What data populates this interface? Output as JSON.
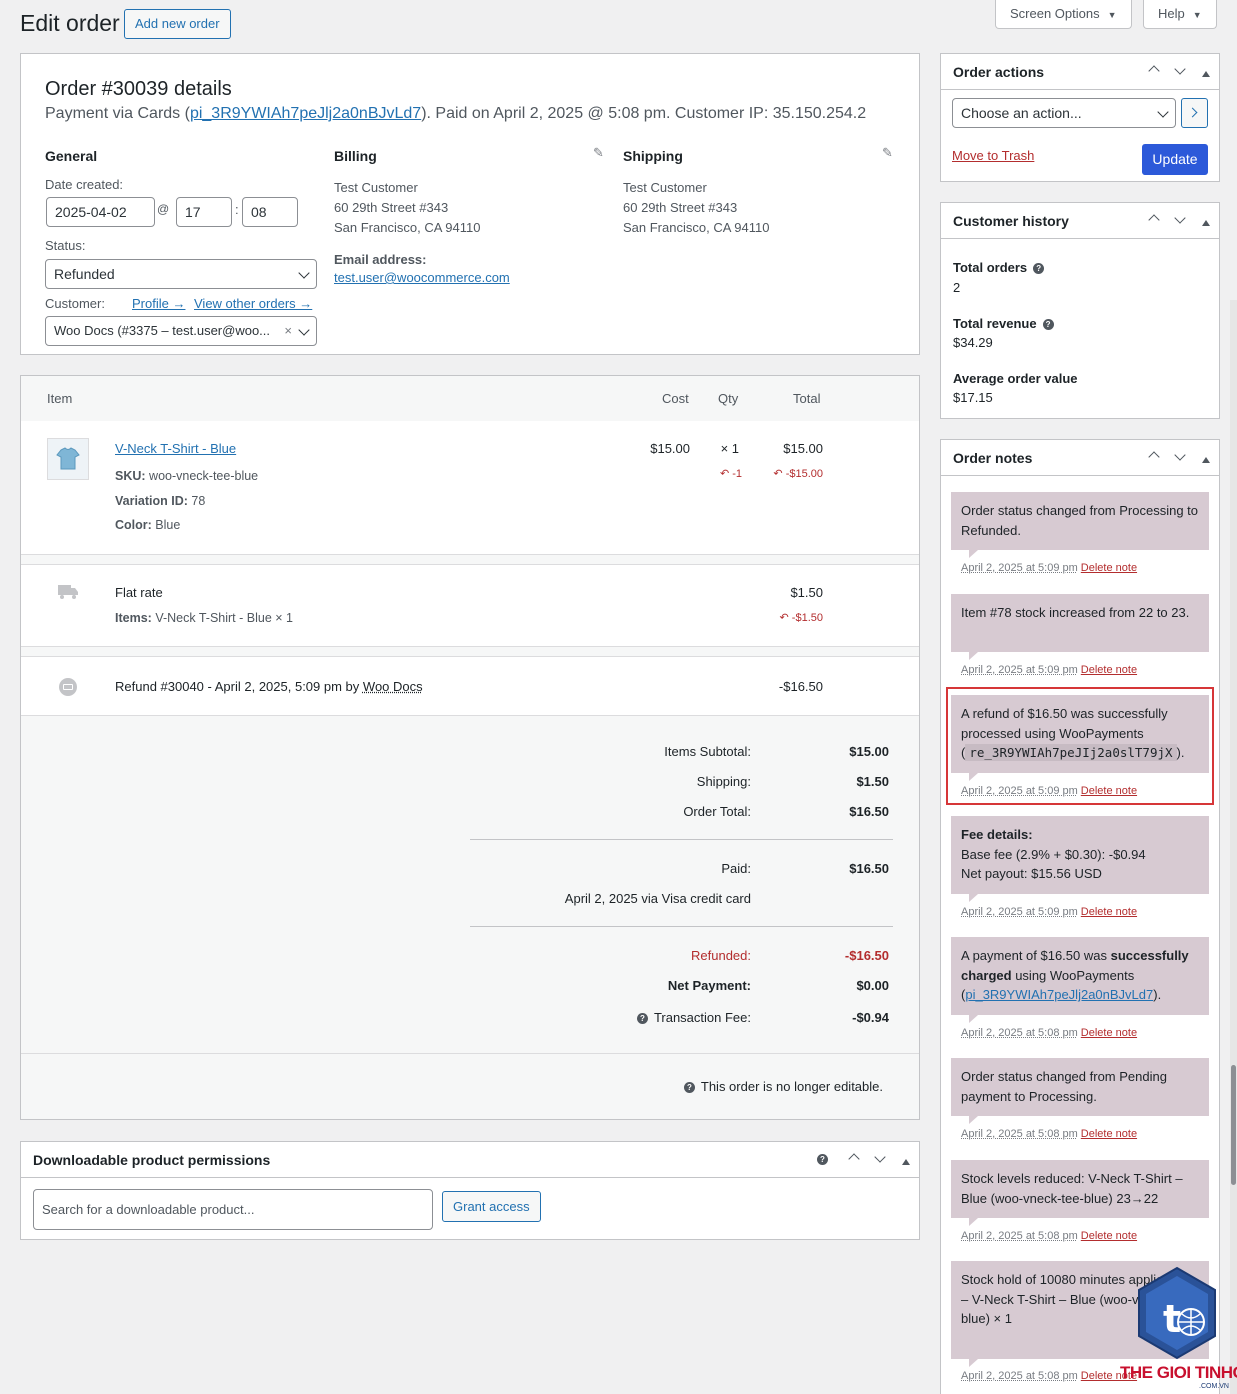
{
  "header": {
    "title": "Edit order",
    "add_new_label": "Add new order",
    "screen_options_label": "Screen Options",
    "help_label": "Help"
  },
  "order": {
    "heading": "Order #30039 details",
    "payment_prefix": "Payment via Cards (",
    "payment_id": "pi_3R9YWIAh7peJlj2a0nBJvLd7",
    "payment_suffix": "). Paid on April 2, 2025 @ 5:08 pm. Customer IP: 35.150.254.2",
    "general": {
      "title": "General",
      "date_label": "Date created:",
      "date": "2025-04-02",
      "hour": "17",
      "minute": "08",
      "at_sign": "@",
      "colon": ":",
      "status_label": "Status:",
      "status": "Refunded",
      "customer_label": "Customer:",
      "profile_link": "Profile →",
      "other_orders_link": "View other orders →",
      "customer": "Woo Docs (#3375 – test.user@woo..."
    },
    "billing": {
      "title": "Billing",
      "name": "Test Customer",
      "street": "60 29th Street #343",
      "city": "San Francisco, CA 94110",
      "email_label": "Email address:",
      "email": "test.user@woocommerce.com"
    },
    "shipping": {
      "title": "Shipping",
      "name": "Test Customer",
      "street": "60 29th Street #343",
      "city": "San Francisco, CA 94110"
    }
  },
  "items": {
    "headers": {
      "item": "Item",
      "cost": "Cost",
      "qty": "Qty",
      "total": "Total"
    },
    "product": {
      "name": "V-Neck T-Shirt - Blue",
      "sku_label": "SKU:",
      "sku": "woo-vneck-tee-blue",
      "variation_label": "Variation ID:",
      "variation": "78",
      "color_label": "Color:",
      "color": "Blue",
      "cost": "$15.00",
      "qty": "× 1",
      "total": "$15.00",
      "refund_qty": "-1",
      "refund_total": "-$15.00"
    },
    "shipping": {
      "name": "Flat rate",
      "items_label": "Items:",
      "items": "V-Neck T-Shirt - Blue × 1",
      "total": "$1.50",
      "refund_total": "-$1.50"
    },
    "refund": {
      "text": "Refund #30040 - April 2, 2025, 5:09 pm by",
      "by": "Woo Docs",
      "total": "-$16.50"
    },
    "totals": {
      "subtotal_label": "Items Subtotal:",
      "subtotal": "$15.00",
      "shipping_label": "Shipping:",
      "shipping": "$1.50",
      "order_total_label": "Order Total:",
      "order_total": "$16.50",
      "paid_label": "Paid:",
      "paid": "$16.50",
      "paid_via": "April 2, 2025 via Visa credit card",
      "refunded_label": "Refunded:",
      "refunded": "-$16.50",
      "net_label": "Net Payment:",
      "net": "$0.00",
      "fee_label": "Transaction Fee:",
      "fee": "-$0.94"
    },
    "not_editable": "This order is no longer editable."
  },
  "downloads": {
    "title": "Downloadable product permissions",
    "search_placeholder": "Search for a downloadable product...",
    "grant_label": "Grant access"
  },
  "order_actions": {
    "title": "Order actions",
    "select": "Choose an action...",
    "trash": "Move to Trash",
    "update": "Update"
  },
  "customer_history": {
    "title": "Customer history",
    "total_orders_label": "Total orders",
    "total_orders": "2",
    "total_revenue_label": "Total revenue",
    "total_revenue": "$34.29",
    "aov_label": "Average order value",
    "aov": "$17.15"
  },
  "order_notes": {
    "title": "Order notes",
    "delete_label": "Delete note",
    "notes": [
      {
        "text": "Order status changed from Processing to Refunded.",
        "date": "April 2, 2025 at 5:09 pm"
      },
      {
        "text": "Item #78 stock increased from 22 to 23.",
        "date": "April 2, 2025 at 5:09 pm"
      },
      {
        "text_a": "A refund of $16.50 was successfully processed using WooPayments",
        "code": "re_3R9YWIAh7peJIj2a0slT79jX",
        "date": "April 2, 2025 at 5:09 pm"
      },
      {
        "title": "Fee details:",
        "line1": "Base fee (2.9% + $0.30): -$0.94",
        "line2": "Net payout: $15.56 USD",
        "date": "April 2, 2025 at 5:09 pm"
      },
      {
        "text_a": "A payment of $16.50 was",
        "bold": "successfully charged",
        "text_b": "using WooPayments",
        "link": "pi_3R9YWIAh7peJlj2a0nBJvLd7",
        "date": "April 2, 2025 at 5:08 pm"
      },
      {
        "text": "Order status changed from Pending payment to Processing.",
        "date": "April 2, 2025 at 5:08 pm"
      },
      {
        "text": "Stock levels reduced: V-Neck T-Shirt – Blue (woo-vneck-tee-blue) 23→22",
        "date": "April 2, 2025 at 5:08 pm"
      },
      {
        "line1": "Stock hold of 10080 minutes applied to:",
        "line2": "– V-Neck T-Shirt – Blue (woo-vneck-tee-blue) × 1",
        "date": "April 2, 2025 at 5:08 pm"
      }
    ]
  },
  "watermark": {
    "brand": "THE GIOI TINHOC",
    "domain": ".COM.VN"
  },
  "colors": {
    "accent": "#2271b1",
    "update_bg": "#2c59d9",
    "note_bg": "#d7cad2",
    "highlight": "#d63638",
    "refund_red": "#b32d2e"
  }
}
